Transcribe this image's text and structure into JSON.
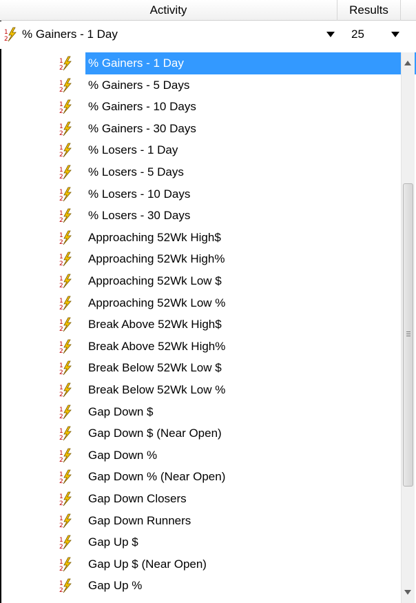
{
  "header": {
    "activity_label": "Activity",
    "results_label": "Results"
  },
  "filter": {
    "activity_value": "% Gainers - 1 Day",
    "results_value": "25"
  },
  "list": {
    "items": [
      "% Gainers - 1 Day",
      "% Gainers -  5 Days",
      "% Gainers - 10 Days",
      "% Gainers - 30 Days",
      "% Losers -  1 Day",
      "% Losers -  5 Days",
      "% Losers - 10 Days",
      "% Losers - 30 Days",
      "Approaching 52Wk High$",
      "Approaching 52Wk High%",
      "Approaching 52Wk Low $",
      "Approaching 52Wk Low %",
      "Break Above 52Wk High$",
      "Break Above 52Wk High%",
      "Break Below 52Wk Low $",
      "Break Below 52Wk Low %",
      "Gap Down $",
      "Gap Down $ (Near Open)",
      "Gap Down %",
      "Gap Down % (Near Open)",
      "Gap Down Closers",
      "Gap Down Runners",
      "Gap Up $",
      "Gap Up $ (Near Open)",
      "Gap Up %"
    ],
    "selected_index": 0,
    "item_icon": "sort-lightning-icon"
  },
  "colors": {
    "selection": "#3399ff",
    "scrollbar_track": "#f0f0f0"
  }
}
